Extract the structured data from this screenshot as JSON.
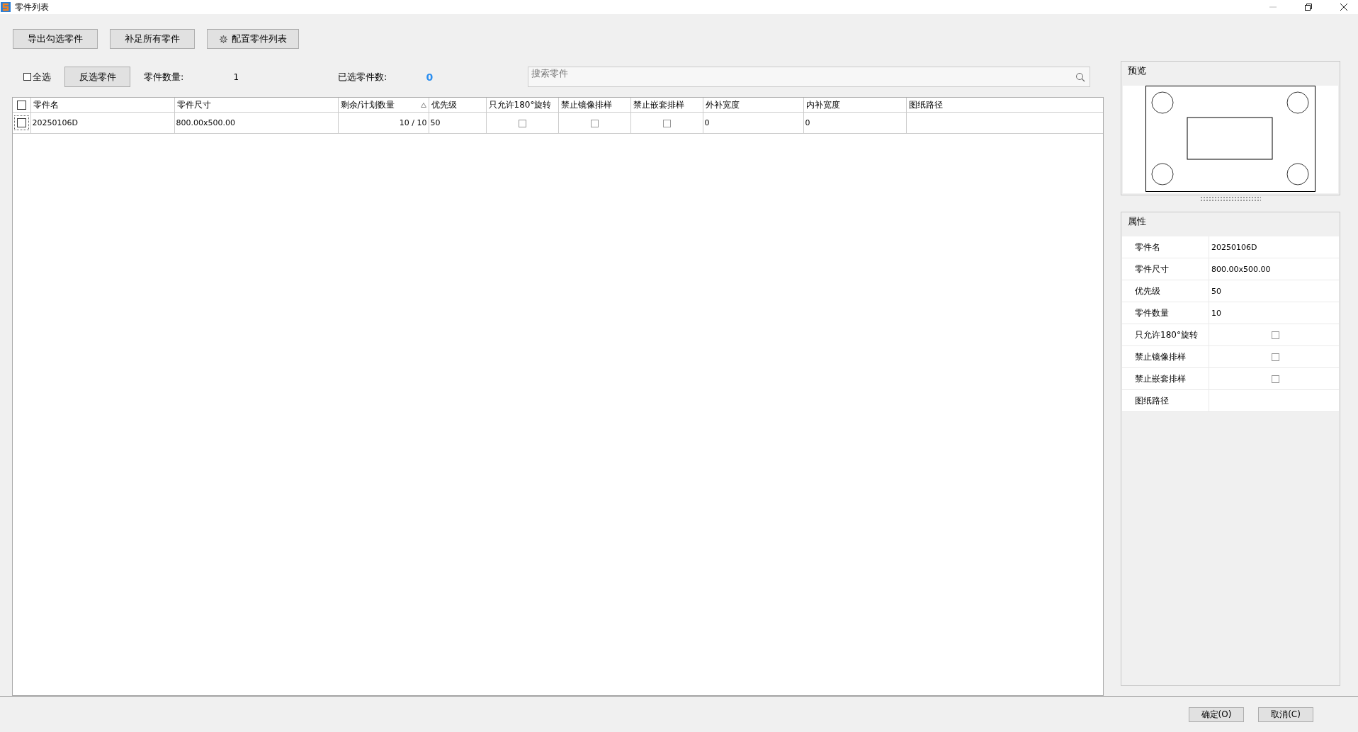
{
  "window": {
    "title": "零件列表"
  },
  "toolbar": {
    "buttons": [
      {
        "label": "导出勾选零件",
        "kind": "plain"
      },
      {
        "label": "补足所有零件",
        "kind": "plain"
      },
      {
        "label": "配置零件列表",
        "kind": "gear"
      }
    ]
  },
  "selection_bar": {
    "select_all": {
      "label": "全选",
      "checked": false
    },
    "invert_button": "反选零件",
    "part_count": {
      "label": "零件数量:",
      "value": "1"
    },
    "selected_count": {
      "label": "已选零件数:",
      "value": "0"
    },
    "search": {
      "placeholder": "搜索零件"
    }
  },
  "table": {
    "header_checked": false,
    "columns": [
      {
        "label": "零件名",
        "sorted": false
      },
      {
        "label": "零件尺寸",
        "sorted": false
      },
      {
        "label": "剩余/计划数量",
        "sorted": true
      },
      {
        "label": "优先级",
        "sorted": false
      },
      {
        "label": "只允许180°旋转",
        "sorted": false
      },
      {
        "label": "禁止镜像排样",
        "sorted": false
      },
      {
        "label": "禁止嵌套排样",
        "sorted": false
      },
      {
        "label": "外补宽度",
        "sorted": false
      },
      {
        "label": "内补宽度",
        "sorted": false
      },
      {
        "label": "图纸路径",
        "sorted": false
      }
    ],
    "rows": [
      {
        "checked": false,
        "cells": [
          {
            "kind": "text",
            "value": "20250106D"
          },
          {
            "kind": "text",
            "value": "800.00x500.00"
          },
          {
            "kind": "number",
            "value": "10 / 10"
          },
          {
            "kind": "text",
            "value": "50"
          },
          {
            "kind": "check",
            "checked": false
          },
          {
            "kind": "check",
            "checked": false
          },
          {
            "kind": "check",
            "checked": false
          },
          {
            "kind": "text",
            "value": "0"
          },
          {
            "kind": "text",
            "value": "0"
          },
          {
            "kind": "text"
          }
        ]
      }
    ]
  },
  "preview": {
    "title": "预览"
  },
  "properties": {
    "title": "属性",
    "rows": [
      {
        "label": "零件名",
        "kind": "text",
        "value": "20250106D"
      },
      {
        "label": "零件尺寸",
        "kind": "text",
        "value": "800.00x500.00"
      },
      {
        "label": "优先级",
        "kind": "text",
        "value": "50"
      },
      {
        "label": "零件数量",
        "kind": "text",
        "value": "10"
      },
      {
        "label": "只允许180°旋转",
        "kind": "check",
        "checked": false
      },
      {
        "label": "禁止镜像排样",
        "kind": "check",
        "checked": false
      },
      {
        "label": "禁止嵌套排样",
        "kind": "check",
        "checked": false
      },
      {
        "label": "图纸路径",
        "kind": "text"
      }
    ]
  },
  "footer": {
    "buttons": [
      "确定(O)",
      "取消(C)"
    ]
  }
}
